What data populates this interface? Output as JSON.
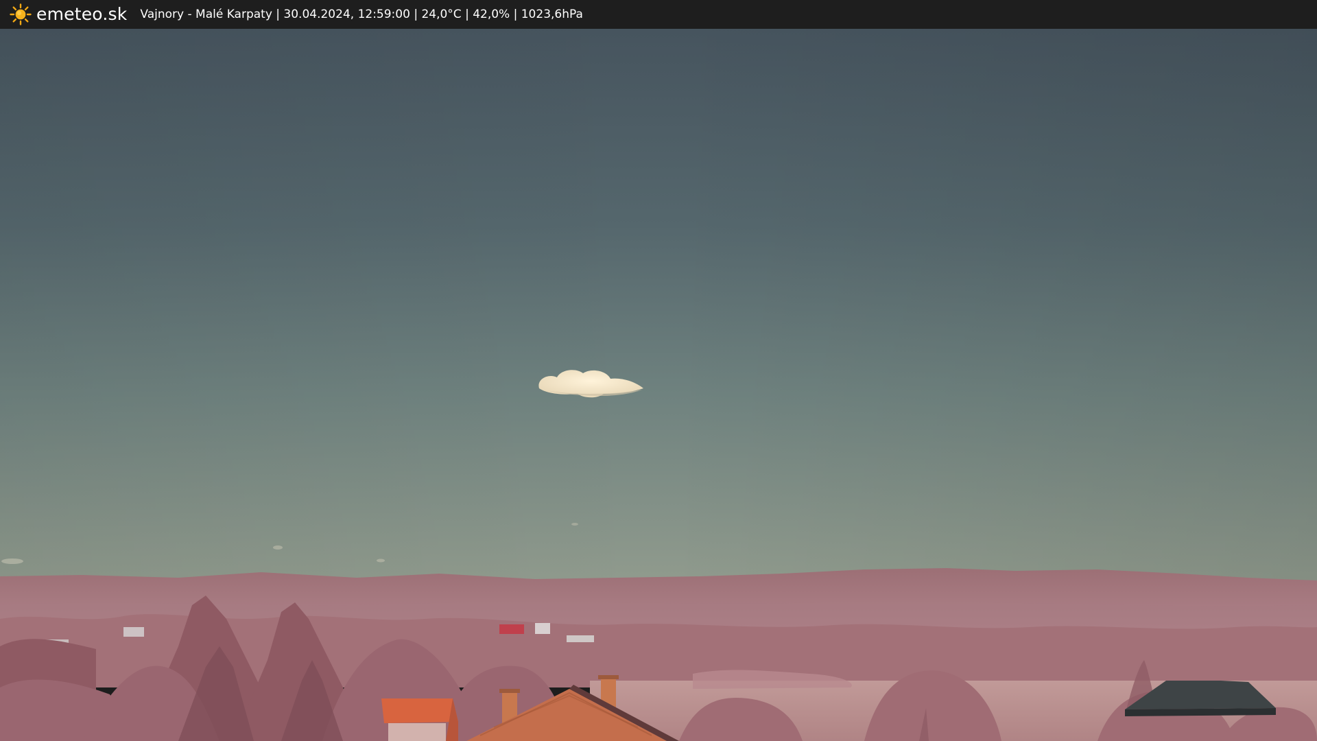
{
  "header": {
    "site_name": "emeteo.sk",
    "station_info": "Vajnory - Malé Karpaty | 30.04.2024, 12:59:00 | 24,0°C | 42,0% | 1023,6hPa",
    "logo_icon": "sun-icon"
  },
  "colors": {
    "header_bg": "#1e1e1e",
    "sun": "#f2a814",
    "sky_top": "#46545e",
    "sky_horizon": "#8e9a8c",
    "vegetation": "#a07076",
    "roof": "#d9653f"
  }
}
